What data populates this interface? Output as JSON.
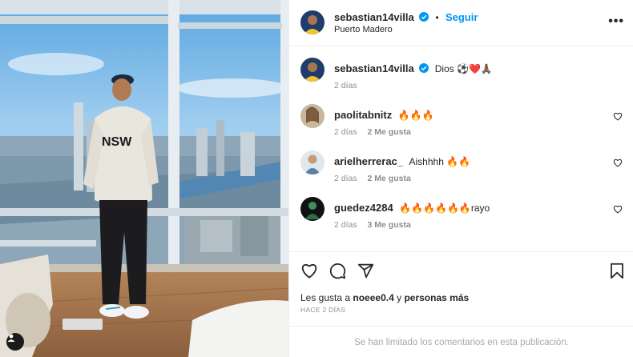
{
  "post": {
    "author": "sebastian14villa",
    "follow_label": "Seguir",
    "separator": "•",
    "location": "Puerto Madero",
    "more_label": "•••"
  },
  "caption": {
    "username": "sebastian14villa",
    "text": "Dios ⚽❤️🙏🏾",
    "time": "2 días"
  },
  "comments": [
    {
      "username": "paolitabnitz",
      "text": "🔥🔥🔥",
      "time": "2 días",
      "likes": "2 Me gusta"
    },
    {
      "username": "arielherrerac_",
      "text": "Aishhhh 🔥🔥",
      "time": "2 días",
      "likes": "2 Me gusta"
    },
    {
      "username": "guedez4284",
      "text": "🔥🔥🔥🔥🔥🔥rayo",
      "time": "2 días",
      "likes": "3 Me gusta"
    }
  ],
  "likes": {
    "prefix": "Les gusta a",
    "user": "noeee0.4",
    "middle": "y",
    "others": "personas más"
  },
  "date": "HACE 2 DÍAS",
  "comments_limited": "Se han limitado los comentarios en esta publicación.",
  "icons": {
    "verified": "verified-badge-icon",
    "like": "heart-outline-icon",
    "comment": "comment-bubble-icon",
    "share": "paper-plane-icon",
    "save": "bookmark-icon",
    "more": "ellipsis-icon"
  },
  "colors": {
    "accent": "#0095f6",
    "muted": "#8e8e8e",
    "text": "#262626"
  }
}
